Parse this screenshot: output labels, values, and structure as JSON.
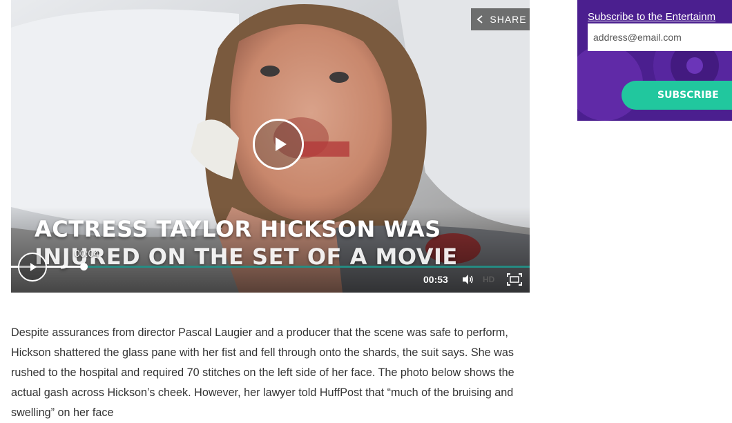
{
  "player": {
    "share_label": "SHARE",
    "caption_line1": "ACTRESS TAYLOR HICKSON WAS",
    "caption_line2": "INJURED ON THE SET OF A MOVIE",
    "current_time_tooltip": "00:04",
    "duration": "00:53",
    "hd_label": "HD",
    "progress_fraction": 0.14,
    "accent_color": "#1b8c82"
  },
  "newsletter": {
    "title": "Subscribe to the Entertainm",
    "email_placeholder": "address@email.com",
    "subscribe_label": "SUBSCRIBE",
    "background_color": "#4b1f8f",
    "button_color": "#21c79e"
  },
  "article": {
    "paragraph": "Despite assurances from director Pascal Laugier and a producer that the scene was safe to perform, Hickson shattered the glass pane with her fist and fell through onto the shards, the suit says. She was rushed to the hospital and required 70 stitches on the left side of her face. The photo below shows the actual gash across Hickson’s cheek. However, her lawyer told HuffPost that “much of the bruising and swelling” on her face"
  },
  "icons": [
    "share-icon",
    "play-icon",
    "volume-icon",
    "fullscreen-icon"
  ]
}
